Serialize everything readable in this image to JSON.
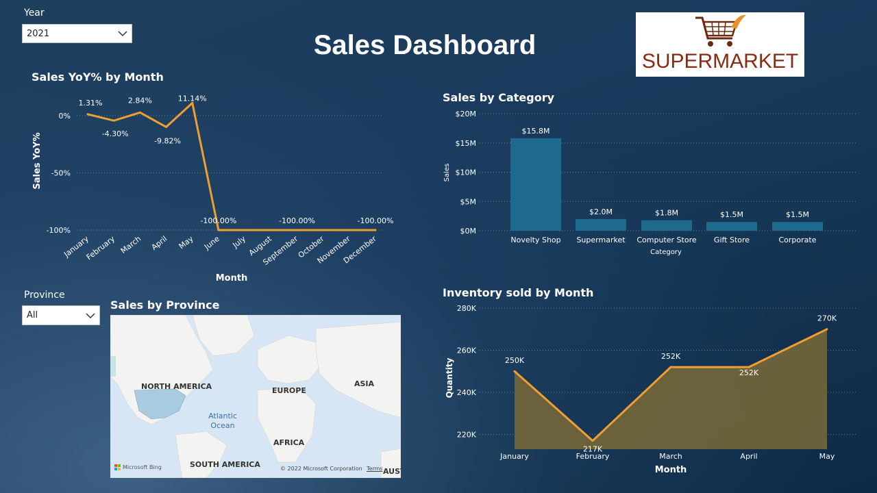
{
  "title": "Sales Dashboard",
  "logo": {
    "text": "SUPERMARKET",
    "icon": "shopping-cart-icon"
  },
  "year_slicer": {
    "label": "Year",
    "value": "2021"
  },
  "province_slicer": {
    "label": "Province",
    "value": "All"
  },
  "colors": {
    "accent": "#f0a030",
    "bar": "#1e6a8c",
    "area_fill": "#7a6a38"
  },
  "yoy_chart": {
    "title": "Sales YoY% by Month",
    "chart_data": {
      "type": "line",
      "title": "Sales YoY% by Month",
      "xlabel": "Month",
      "ylabel": "Sales YoY%",
      "ylim": [
        -100,
        10
      ],
      "yticks": [
        "0%",
        "-50%",
        "-100%"
      ],
      "categories": [
        "January",
        "February",
        "March",
        "April",
        "May",
        "June",
        "July",
        "August",
        "September",
        "October",
        "November",
        "December"
      ],
      "values": [
        1.31,
        -4.3,
        2.84,
        -9.82,
        11.14,
        -100,
        -100,
        -100,
        -100,
        -100,
        -100,
        -100
      ],
      "data_labels": [
        "1.31%",
        "-4.30%",
        "2.84%",
        "-9.82%",
        "11.14%",
        "-100.00%",
        "",
        "",
        "-100.00%",
        "",
        "",
        "-100.00%"
      ]
    }
  },
  "category_chart": {
    "title": "Sales by Category",
    "chart_data": {
      "type": "bar",
      "title": "Sales by Category",
      "xlabel": "Category",
      "ylabel": "Sales",
      "ylim": [
        0,
        20
      ],
      "yticks": [
        "$20M",
        "$15M",
        "$10M",
        "$5M",
        "$0M"
      ],
      "categories": [
        "Novelty Shop",
        "Supermarket",
        "Computer Store",
        "Gift Store",
        "Corporate"
      ],
      "values": [
        15.8,
        2.0,
        1.8,
        1.5,
        1.5
      ],
      "data_labels": [
        "$15.8M",
        "$2.0M",
        "$1.8M",
        "$1.5M",
        "$1.5M"
      ]
    }
  },
  "inventory_chart": {
    "title": "Inventory sold by Month",
    "chart_data": {
      "type": "area",
      "title": "Inventory sold by Month",
      "xlabel": "Month",
      "ylabel": "Quantity",
      "ylim": [
        213,
        280
      ],
      "yticks": [
        "280K",
        "260K",
        "240K",
        "220K"
      ],
      "categories": [
        "January",
        "February",
        "March",
        "April",
        "May"
      ],
      "values": [
        250,
        217,
        252,
        252,
        270
      ],
      "data_labels": [
        "250K",
        "217K",
        "252K",
        "252K",
        "270K"
      ]
    }
  },
  "map": {
    "title": "Sales by Province",
    "labels": [
      "NORTH AMERICA",
      "EUROPE",
      "ASIA",
      "Atlantic Ocean",
      "AFRICA",
      "SOUTH AMERICA",
      "AUST"
    ],
    "attribution": "© 2022 Microsoft Corporation",
    "terms": "Terms",
    "bing": "Microsoft Bing"
  }
}
